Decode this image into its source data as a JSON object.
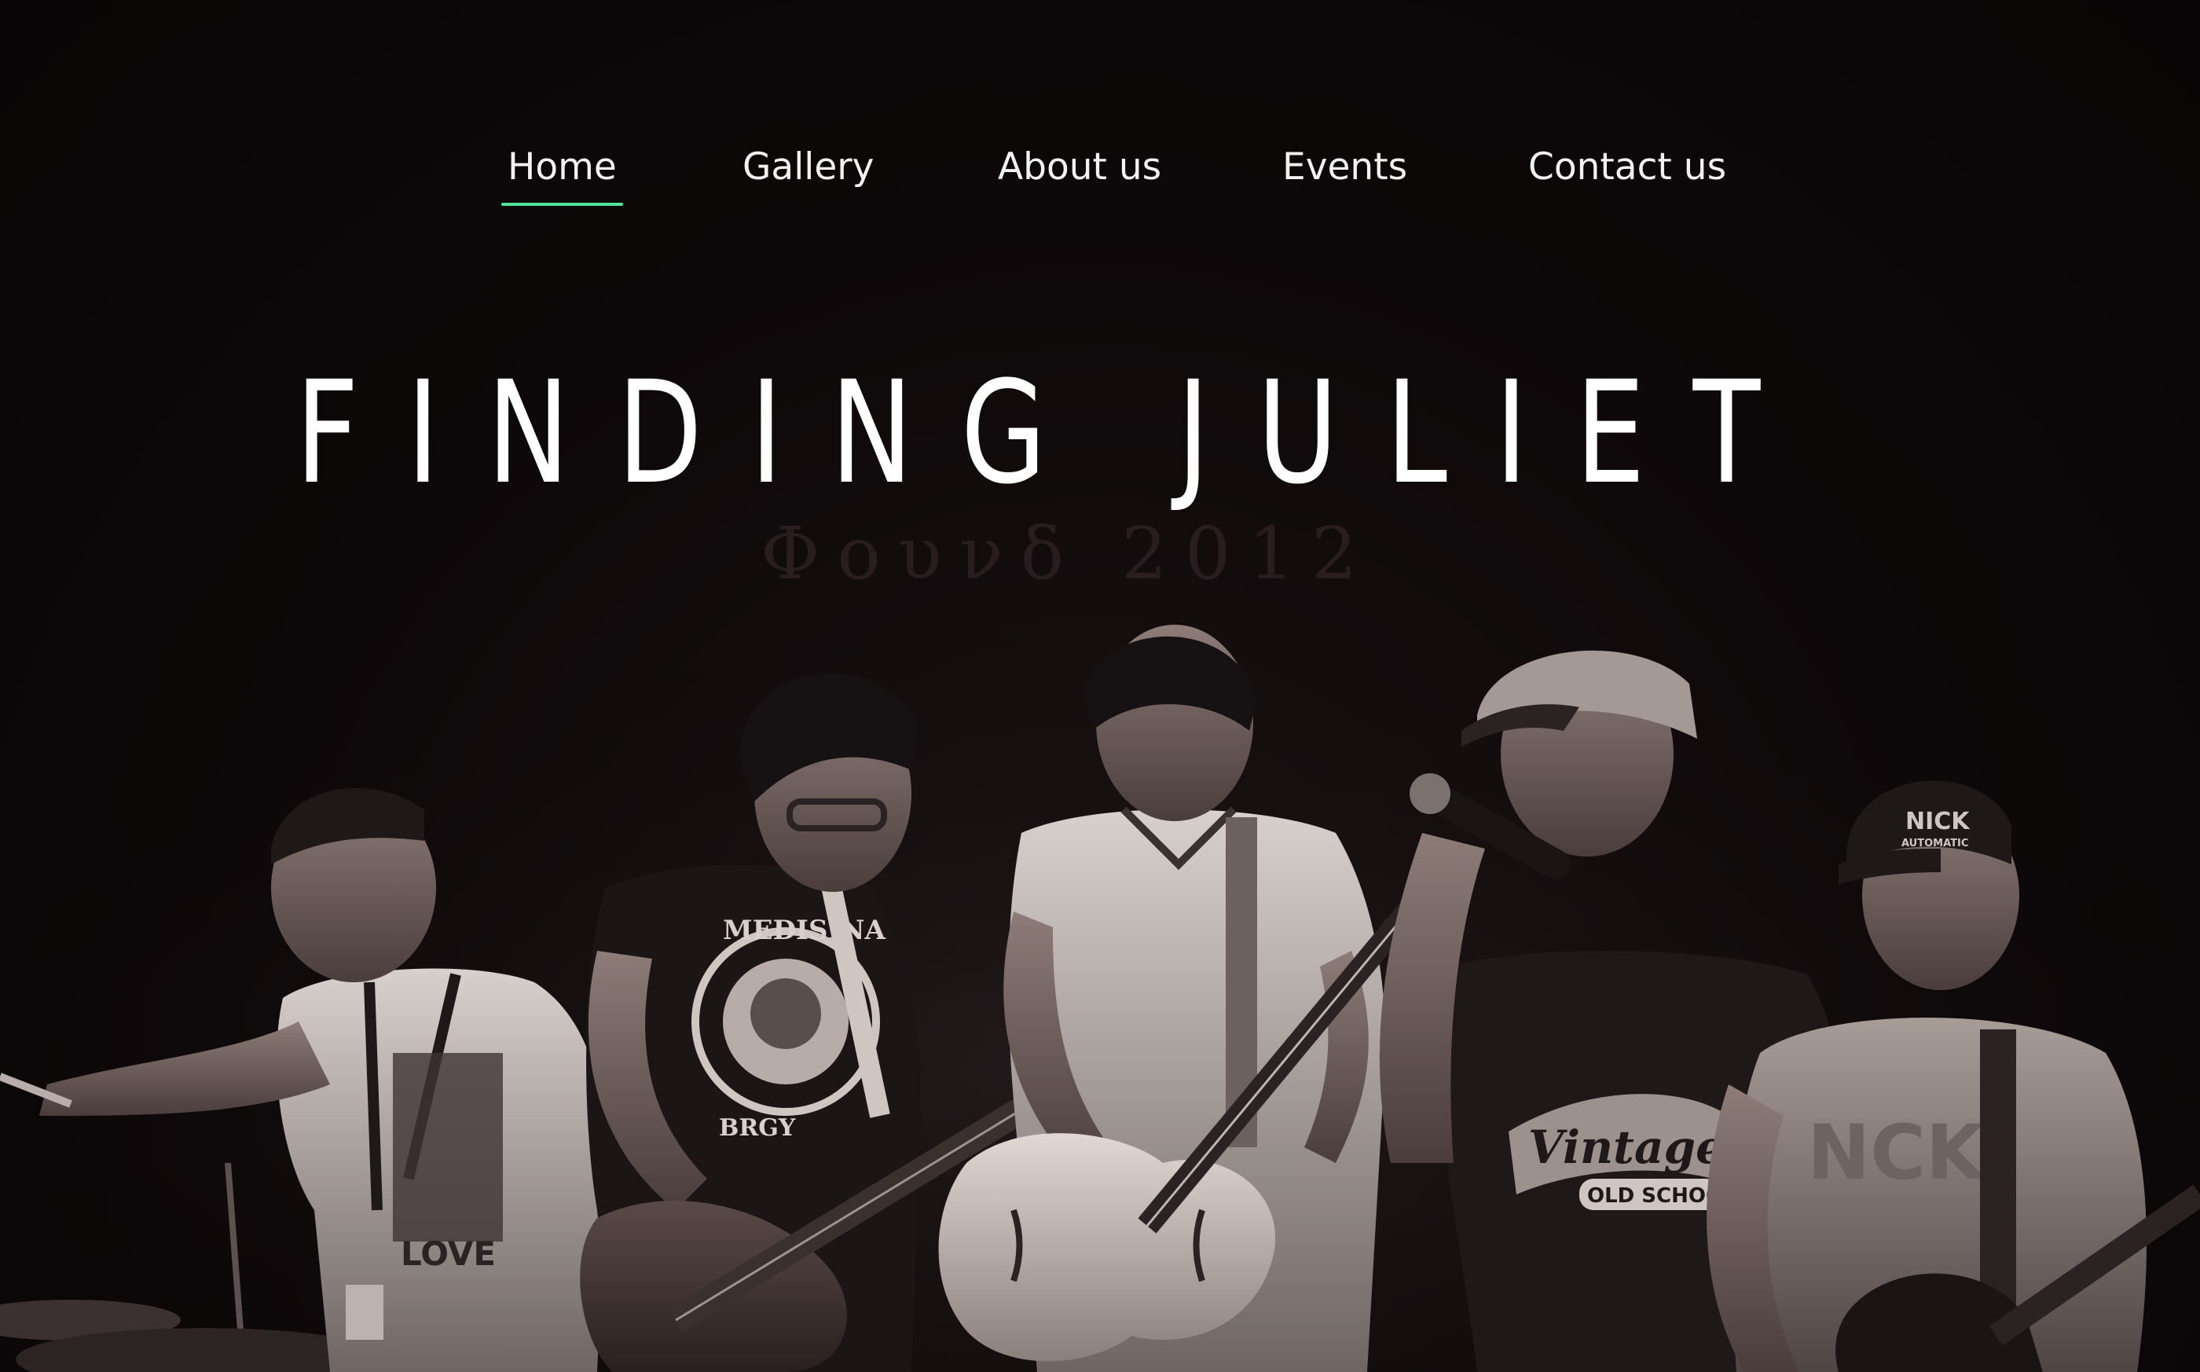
{
  "theme": {
    "background": "#0b0607",
    "text": "#f2f2f2",
    "accent": "#53e39a"
  },
  "nav": {
    "items": [
      {
        "label": "Home",
        "active": true
      },
      {
        "label": "Gallery",
        "active": false
      },
      {
        "label": "About us",
        "active": false
      },
      {
        "label": "Events",
        "active": false
      },
      {
        "label": "Contact us",
        "active": false
      }
    ]
  },
  "hero": {
    "title": "FINDING JULIET",
    "subtitle": "Φουνδ 2012"
  },
  "photo": {
    "shirt_texts": {
      "medisina": "MEDISINA",
      "brgy": "BRGY",
      "vintage": "Vintage",
      "old_school": "OLD SCHOOL",
      "nick_cap": "NICK",
      "nick_automatic": "AUTOMATIC",
      "nick_shirt": "NCK",
      "love": "LOVE"
    }
  }
}
